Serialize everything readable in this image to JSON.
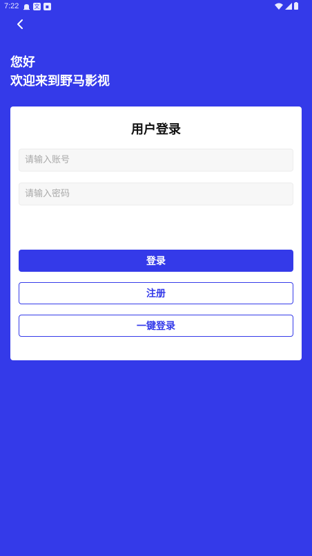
{
  "status_bar": {
    "time": "7:22",
    "left_icons": [
      "notification-icon",
      "translate-icon",
      "app-icon"
    ],
    "right_icons": [
      "wifi-icon",
      "signal-icon",
      "battery-icon"
    ]
  },
  "greeting": {
    "line1": "您好",
    "line2": "欢迎来到野马影视"
  },
  "login_card": {
    "title": "用户登录",
    "account_placeholder": "请输入账号",
    "password_placeholder": "请输入密码",
    "login_label": "登录",
    "register_label": "注册",
    "quick_login_label": "一键登录"
  },
  "colors": {
    "background": "#343ae9",
    "primary": "#343ae9",
    "card": "#ffffff"
  }
}
